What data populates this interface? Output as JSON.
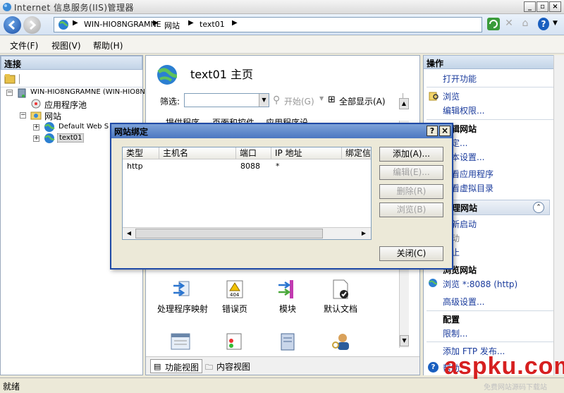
{
  "window": {
    "title": "Internet 信息服务(IIS)管理器"
  },
  "address": {
    "crumbs": [
      "WIN-HIO8NGRAMNE",
      "网站",
      "text01"
    ]
  },
  "menu": {
    "items": [
      "文件(F)",
      "视图(V)",
      "帮助(H)"
    ]
  },
  "connections": {
    "header": "连接",
    "tree": {
      "server": "WIN-HIO8NGRAMNE (WIN-HIO8N",
      "app_pools": "应用程序池",
      "sites": "网站",
      "default_site": "Default Web S",
      "text01": "text01"
    }
  },
  "center": {
    "title": "text01 主页",
    "filter_label": "筛选:",
    "start_label": "开始(G)",
    "show_all_label": "全部显示(A)",
    "top_features": [
      "提供程序",
      "页面和控件",
      "应用程序设"
    ],
    "features": [
      "处理程序映射",
      "错误页",
      "模块",
      "默认文档"
    ],
    "tabs": {
      "features": "功能视图",
      "content": "内容视图"
    }
  },
  "actions": {
    "header": "操作",
    "open_feature": "打开功能",
    "browse": "浏览",
    "edit_perm": "编辑权限...",
    "edit_site_section": "编辑网站",
    "bind": "绑定...",
    "basic_settings": "基本设置...",
    "view_apps": "查看应用程序",
    "view_vdirs": "查看虚拟目录",
    "manage_section": "管理网站",
    "restart": "重新启动",
    "start": "启动",
    "stop": "停止",
    "browse_section": "浏览网站",
    "browse_http": "浏览 *:8088 (http)",
    "advanced": "高级设置...",
    "config_section": "配置",
    "limits": "限制...",
    "ftp_publish": "添加 FTP 发布...",
    "help": "帮助"
  },
  "status": {
    "text": "就绪"
  },
  "dialog": {
    "title": "网站绑定",
    "columns": [
      "类型",
      "主机名",
      "端口",
      "IP 地址",
      "绑定信"
    ],
    "rows": [
      {
        "type": "http",
        "host": "",
        "port": "8088",
        "ip": "*"
      }
    ],
    "buttons": {
      "add": "添加(A)...",
      "edit": "编辑(E)...",
      "remove": "删除(R)",
      "browse": "浏览(B)",
      "close": "关闭(C)"
    },
    "help_btn": "?",
    "close_btn": "×"
  },
  "watermark": {
    "text": "aspku.com",
    "sub": "免费网站源码下载站"
  }
}
